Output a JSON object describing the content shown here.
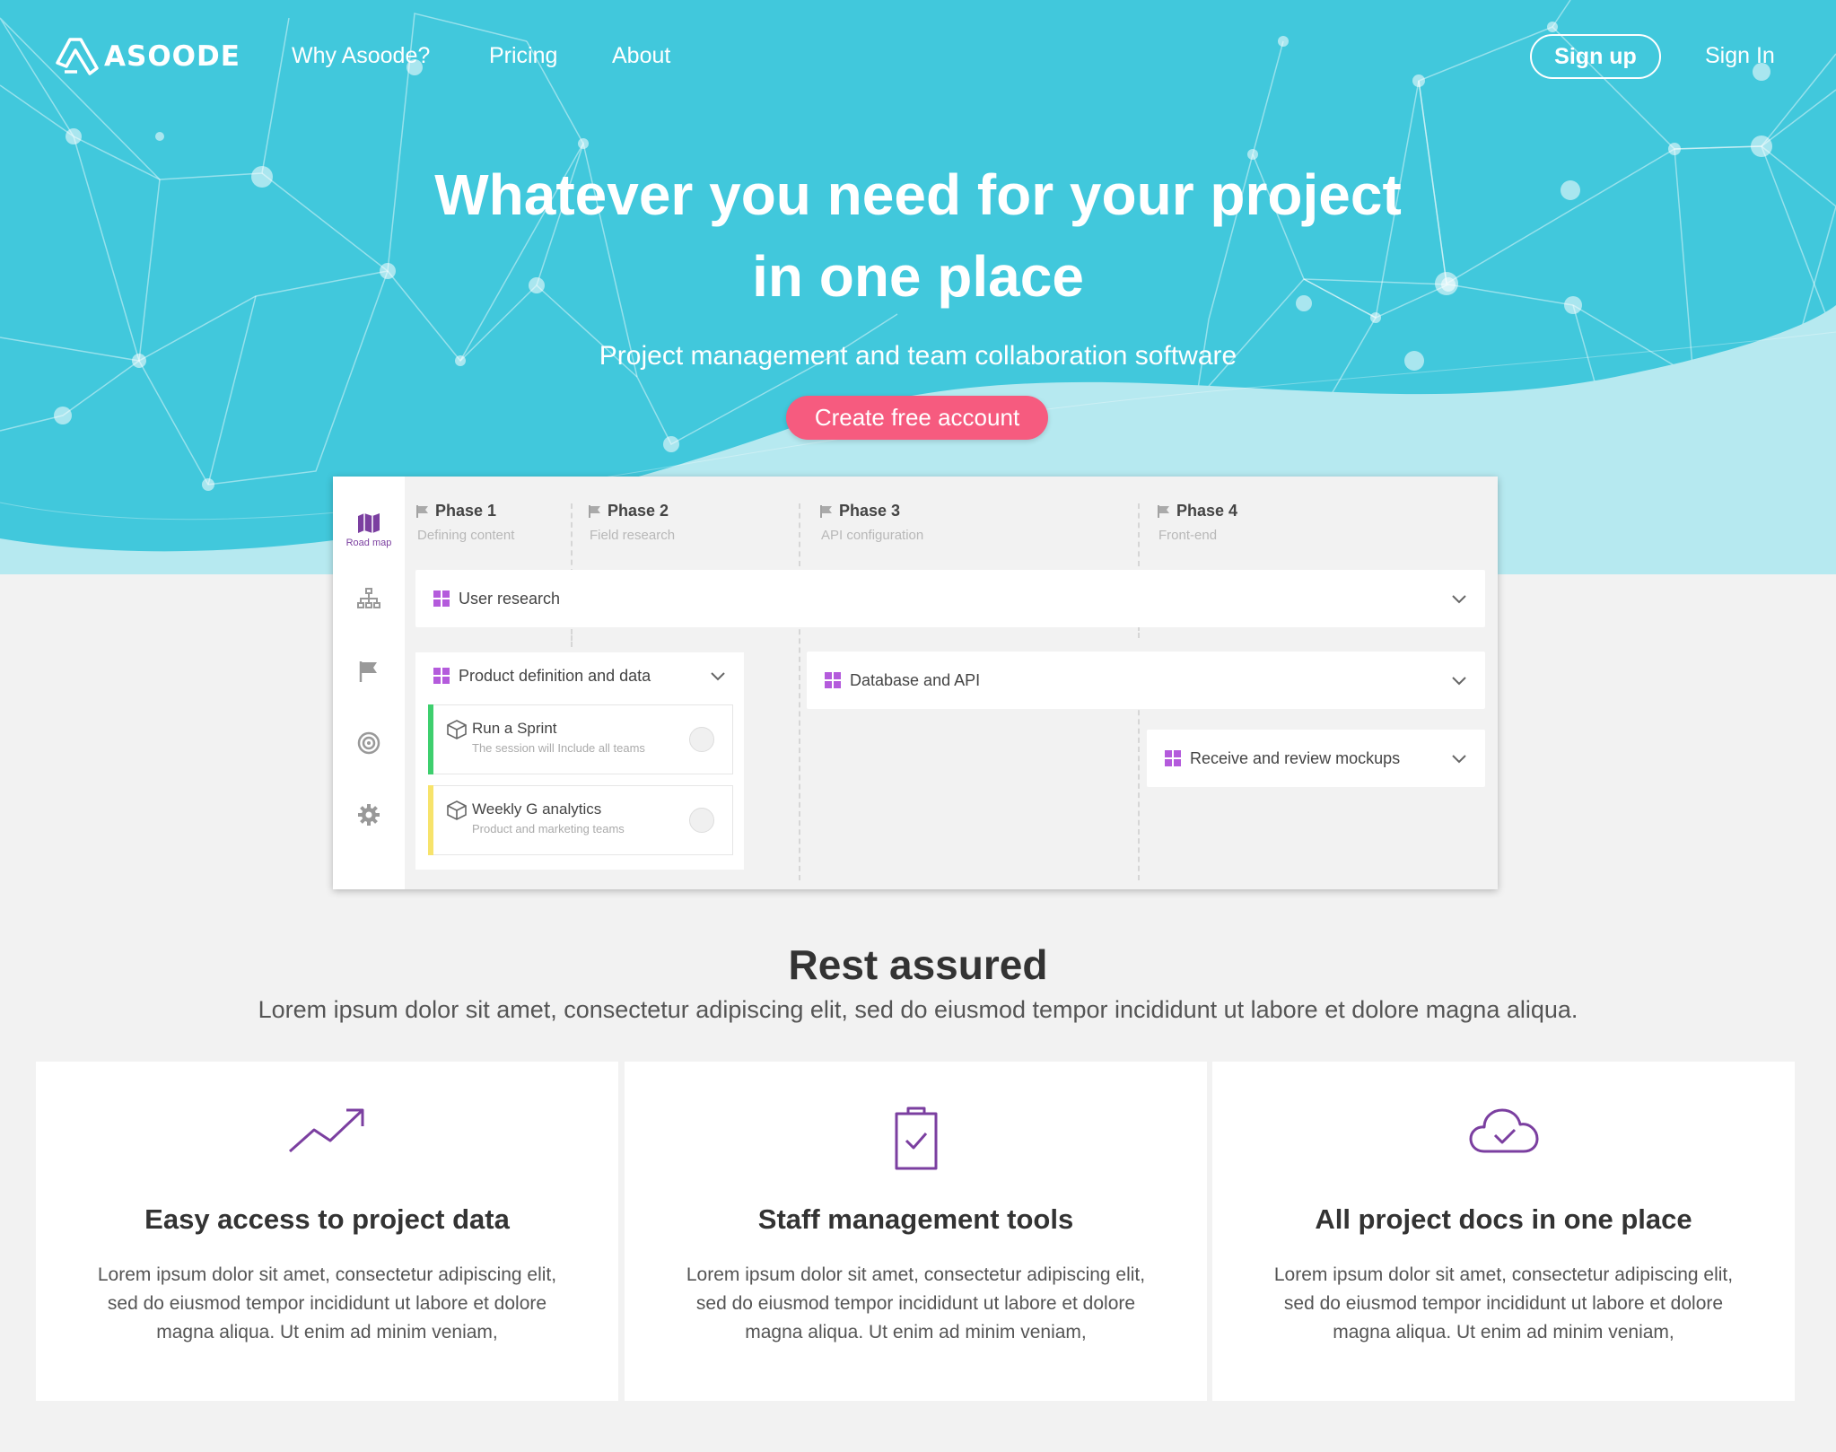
{
  "brand": {
    "name": "ASOODE"
  },
  "nav": {
    "links": [
      "Why Asoode?",
      "Pricing",
      "About"
    ],
    "signup": "Sign up",
    "signin": "Sign In"
  },
  "hero": {
    "title_line1": "Whatever you need for your project",
    "title_line2": "in one place",
    "subtitle": "Project management and team collaboration software",
    "cta": "Create free account"
  },
  "app": {
    "sidebar": {
      "active_label": "Road map",
      "icons": [
        "roadmap-icon",
        "org-chart-icon",
        "flag-icon",
        "target-icon",
        "settings-icon"
      ]
    },
    "phases": [
      {
        "name": "Phase 1",
        "desc": "Defining content"
      },
      {
        "name": "Phase 2",
        "desc": "Field research"
      },
      {
        "name": "Phase 3",
        "desc": "API configuration"
      },
      {
        "name": "Phase 4",
        "desc": "Front-end"
      }
    ],
    "bars": {
      "user_research": "User research",
      "product_definition": "Product definition and data",
      "database_api": "Database and API",
      "mockups": "Receive and review mockups"
    },
    "tasks": [
      {
        "title": "Run a Sprint",
        "sub": "The session will Include all teams",
        "color": "#3ecf6e"
      },
      {
        "title": "Weekly G analytics",
        "sub": "Product and marketing teams",
        "color": "#f7e36b"
      }
    ]
  },
  "section": {
    "title": "Rest assured",
    "subtitle": "Lorem ipsum dolor sit amet, consectetur adipiscing elit, sed do eiusmod tempor incididunt ut labore et dolore magna aliqua."
  },
  "features": [
    {
      "icon": "trending-up-icon",
      "title": "Easy access to project data",
      "text": "Lorem ipsum dolor sit amet, consectetur adipiscing elit, sed do eiusmod tempor incididunt ut labore et dolore magna aliqua. Ut enim ad minim veniam,"
    },
    {
      "icon": "clipboard-check-icon",
      "title": "Staff management tools",
      "text": "Lorem ipsum dolor sit amet, consectetur adipiscing elit, sed do eiusmod tempor incididunt ut labore et dolore magna aliqua. Ut enim ad minim veniam,"
    },
    {
      "icon": "cloud-check-icon",
      "title": "All project docs in one place",
      "text": "Lorem ipsum dolor sit amet, consectetur adipiscing elit, sed do eiusmod tempor incididunt ut labore et dolore magna aliqua. Ut enim ad minim veniam,"
    }
  ],
  "colors": {
    "hero_bg": "#41c8dc",
    "cta": "#f65b7f",
    "accent_purple": "#7b3fa0",
    "grid_icon": "#b45bdc",
    "page_bg": "#f2f2f2"
  }
}
